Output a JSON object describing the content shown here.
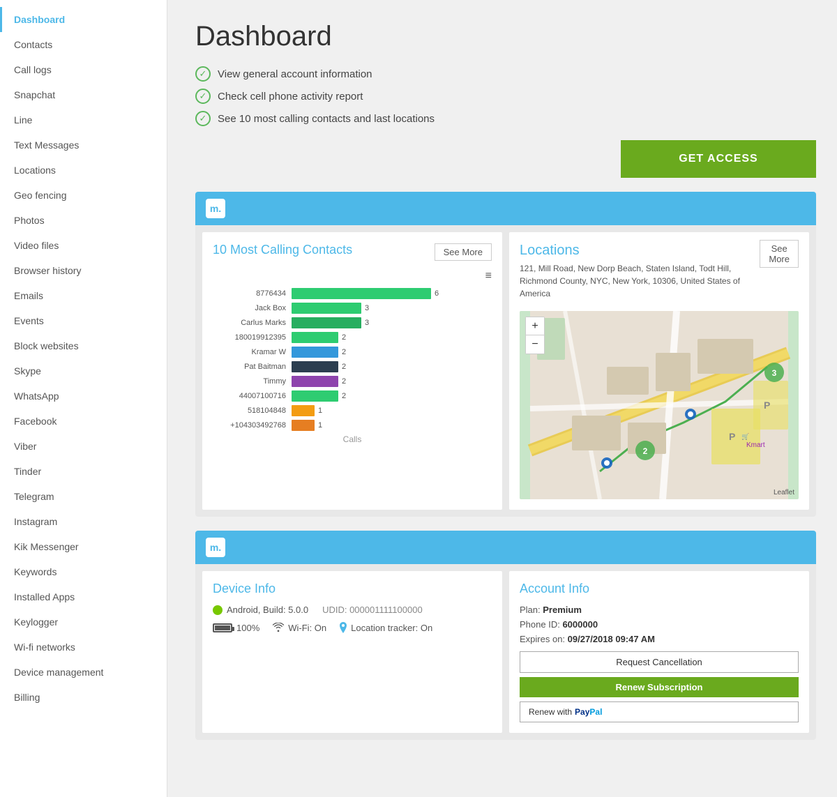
{
  "sidebar": {
    "items": [
      {
        "label": "Dashboard",
        "active": true
      },
      {
        "label": "Contacts",
        "active": false
      },
      {
        "label": "Call logs",
        "active": false
      },
      {
        "label": "Snapchat",
        "active": false
      },
      {
        "label": "Line",
        "active": false
      },
      {
        "label": "Text Messages",
        "active": false
      },
      {
        "label": "Locations",
        "active": false
      },
      {
        "label": "Geo fencing",
        "active": false
      },
      {
        "label": "Photos",
        "active": false
      },
      {
        "label": "Video files",
        "active": false
      },
      {
        "label": "Browser history",
        "active": false
      },
      {
        "label": "Emails",
        "active": false
      },
      {
        "label": "Events",
        "active": false
      },
      {
        "label": "Block websites",
        "active": false
      },
      {
        "label": "Skype",
        "active": false
      },
      {
        "label": "WhatsApp",
        "active": false
      },
      {
        "label": "Facebook",
        "active": false
      },
      {
        "label": "Viber",
        "active": false
      },
      {
        "label": "Tinder",
        "active": false
      },
      {
        "label": "Telegram",
        "active": false
      },
      {
        "label": "Instagram",
        "active": false
      },
      {
        "label": "Kik Messenger",
        "active": false
      },
      {
        "label": "Keywords",
        "active": false
      },
      {
        "label": "Installed Apps",
        "active": false
      },
      {
        "label": "Keylogger",
        "active": false
      },
      {
        "label": "Wi-fi networks",
        "active": false
      },
      {
        "label": "Device management",
        "active": false
      },
      {
        "label": "Billing",
        "active": false
      }
    ]
  },
  "page": {
    "title": "Dashboard",
    "features": [
      "View general account information",
      "Check cell phone activity report",
      "See 10 most calling contacts and last locations"
    ],
    "get_access_label": "GET ACCESS"
  },
  "calling_contacts": {
    "title": "10 Most Calling Contacts",
    "see_more_label": "See More",
    "x_label": "Calls",
    "bars": [
      {
        "label": "8776434",
        "value": 6,
        "color": "#2ecc71",
        "max": 6
      },
      {
        "label": "Jack Box",
        "value": 3,
        "color": "#2ecc71",
        "max": 6
      },
      {
        "label": "Carlus Marks",
        "value": 3,
        "color": "#27ae60",
        "max": 6
      },
      {
        "label": "180019912395",
        "value": 2,
        "color": "#2ecc71",
        "max": 6
      },
      {
        "label": "Kramar W",
        "value": 2,
        "color": "#3498db",
        "max": 6
      },
      {
        "label": "Pat Baitman",
        "value": 2,
        "color": "#2c3e50",
        "max": 6
      },
      {
        "label": "Timmy",
        "value": 2,
        "color": "#8e44ad",
        "max": 6
      },
      {
        "label": "44007100716",
        "value": 2,
        "color": "#2ecc71",
        "max": 6
      },
      {
        "label": "518104848",
        "value": 1,
        "color": "#f39c12",
        "max": 6
      },
      {
        "label": "+104303492768",
        "value": 1,
        "color": "#e67e22",
        "max": 6
      }
    ]
  },
  "locations": {
    "title": "Locations",
    "address": "121, Mill Road, New Dorp Beach, Staten Island, Todt Hill, Richmond County, NYC, New York, 10306, United States of America",
    "see_more_label": "See More",
    "zoom_plus": "+",
    "zoom_minus": "−",
    "leaflet_label": "Leaflet"
  },
  "device_info": {
    "title": "Device Info",
    "os": "Android, Build: 5.0.0",
    "udid": "UDID: 000001111100000",
    "battery_percent": "100%",
    "wifi_status": "Wi-Fi: On",
    "location_tracker": "Location tracker: On"
  },
  "account_info": {
    "title": "Account Info",
    "plan_label": "Plan:",
    "plan_value": "Premium",
    "phone_id_label": "Phone ID:",
    "phone_id_value": "6000000",
    "expires_label": "Expires on:",
    "expires_value": "09/27/2018 09:47 AM",
    "request_cancellation_label": "Request Cancellation",
    "renew_label": "Renew Subscription",
    "paypal_label": "Renew with",
    "paypal_brand": "PayPal"
  }
}
